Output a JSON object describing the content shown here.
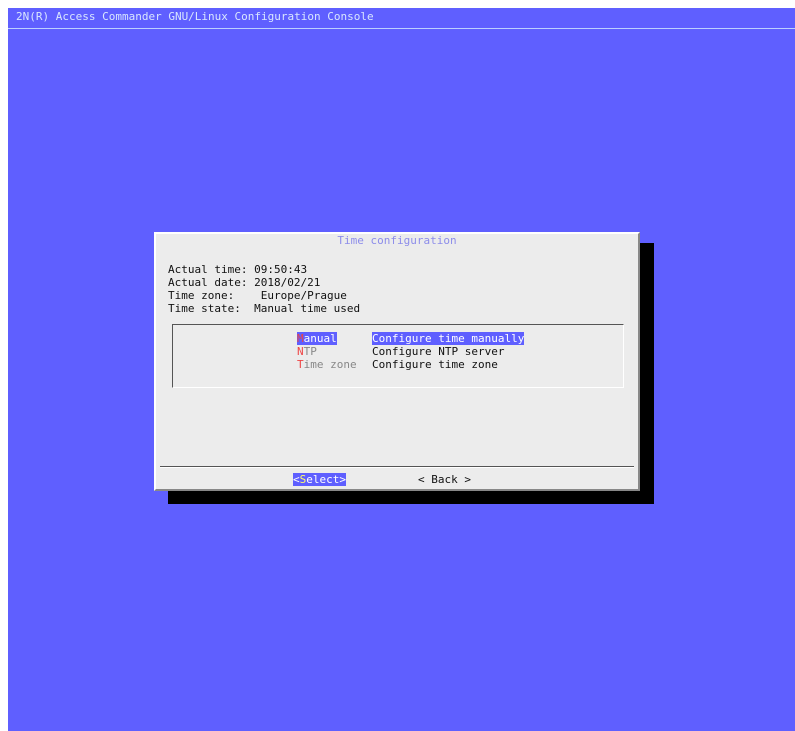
{
  "console": {
    "title": "2N(R) Access Commander GNU/Linux Configuration Console"
  },
  "dialog": {
    "title": "Time configuration",
    "info": [
      {
        "label": "Actual time:",
        "value": "09:50:43"
      },
      {
        "label": "Actual date:",
        "value": "2018/02/21"
      },
      {
        "label": "Time zone:",
        "value": "Europe/Prague"
      },
      {
        "label": "Time state:",
        "value": "Manual time used"
      }
    ],
    "menu": [
      {
        "hot": "M",
        "rest": "anual",
        "desc": "Configure time manually",
        "selected": true
      },
      {
        "hot": "N",
        "rest": "TP",
        "desc": "Configure NTP server",
        "selected": false
      },
      {
        "hot": "T",
        "rest": "ime zone",
        "desc": "Configure time zone",
        "selected": false
      }
    ],
    "buttons": {
      "select": {
        "open": "<",
        "hot": "S",
        "rest": "elect>"
      },
      "back": "< Back >"
    }
  },
  "colors": {
    "background": "#5f5fff",
    "dialog": "#ececec",
    "highlight": "#5f5fff",
    "hotkey": "#ee4444"
  }
}
